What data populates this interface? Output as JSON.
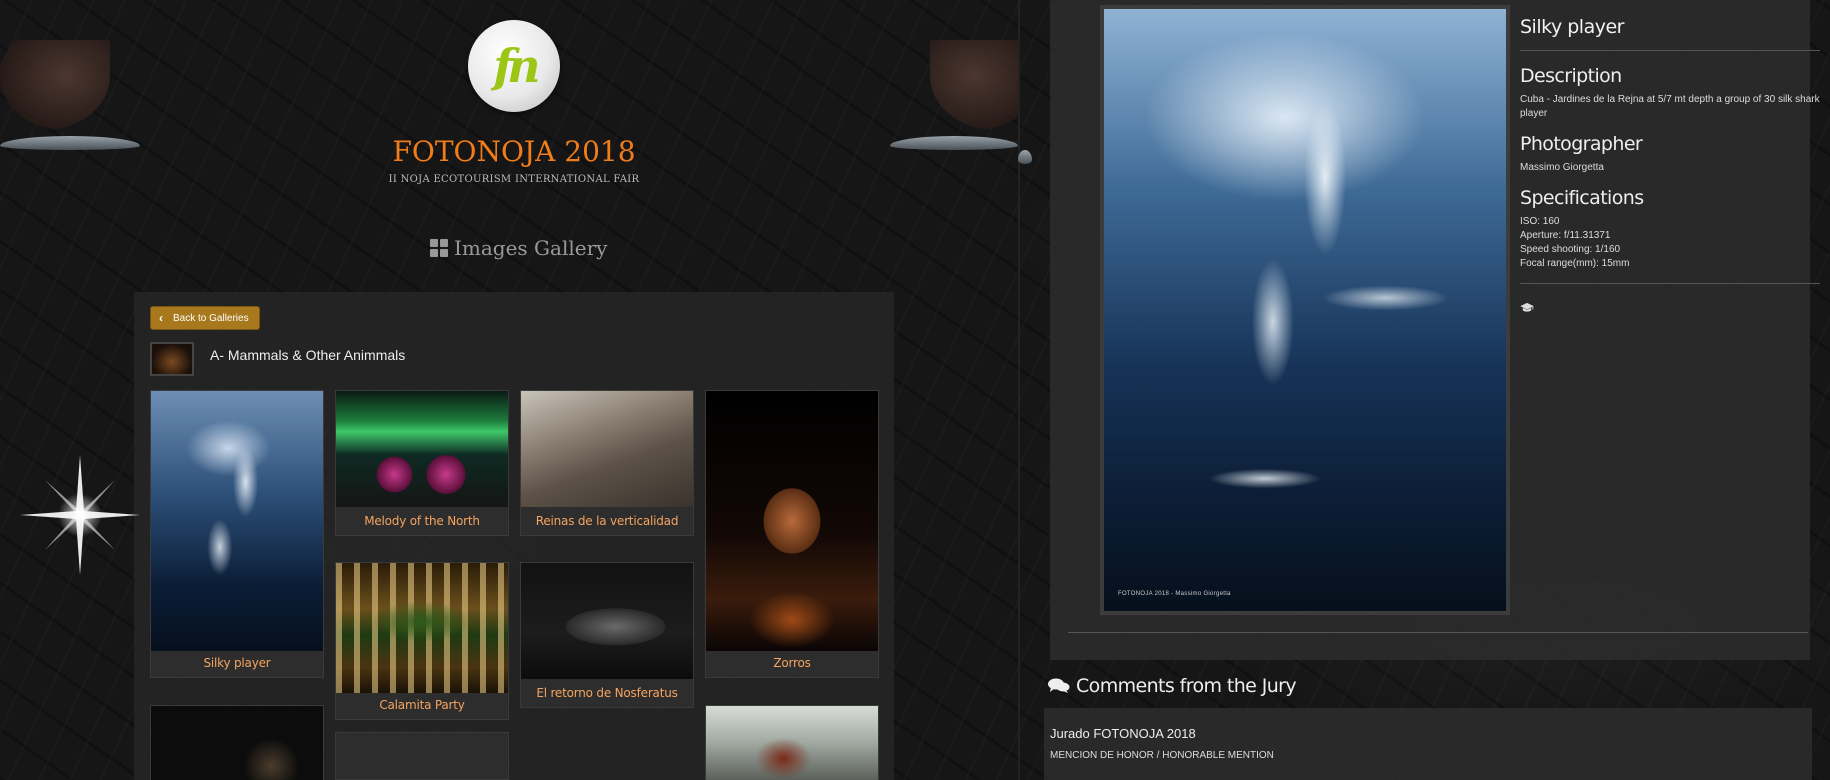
{
  "site": {
    "logo_text": "fn",
    "title": "FOTONOJA 2018",
    "subtitle": "II NOJA ECOTOURISM INTERNATIONAL FAIR",
    "gallery_heading": "Images Gallery",
    "brand_color": "#f07c1a"
  },
  "gallery": {
    "back_label": "Back to Galleries",
    "category_title": "A- Mammals & Other Animmals",
    "items": [
      {
        "caption": "Silky player"
      },
      {
        "caption": "Melody of the North"
      },
      {
        "caption": "Reinas de la verticalidad"
      },
      {
        "caption": "Zorros"
      },
      {
        "caption": "Calamita Party"
      },
      {
        "caption": "El retorno de Nosferatus"
      }
    ]
  },
  "photo": {
    "title": "Silky player",
    "credit": "FOTONOJA 2018 - Massimo Giorgetta",
    "description_heading": "Description",
    "description": "Cuba - Jardines de la Rejna at 5/7 mt depth a group of 30 silk shark player",
    "photographer_heading": "Photographer",
    "photographer": "Massimo Giorgetta",
    "specifications_heading": "Specifications",
    "specs": {
      "iso": "ISO: 160",
      "aperture": "Aperture: f/11.31371",
      "speed": "Speed shooting: 1/160",
      "focal": "Focal range(mm): 15mm"
    }
  },
  "comments": {
    "heading": "Comments from the Jury",
    "items": [
      {
        "author": "Jurado FOTONOJA 2018",
        "text": "MENCION DE HONOR / HONORABLE MENTION"
      }
    ]
  },
  "icons": [
    "grid-icon",
    "chevron-left-icon",
    "graduation-cap-icon",
    "comments-icon",
    "sparkle-icon"
  ]
}
